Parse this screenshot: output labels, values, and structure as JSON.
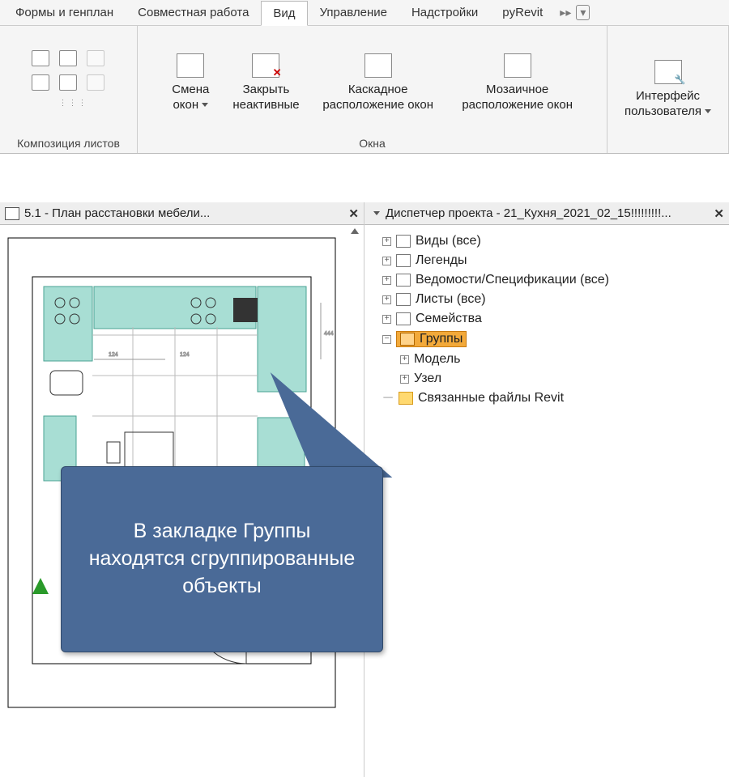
{
  "ribbon": {
    "tabs": [
      "Формы и генплан",
      "Совместная работа",
      "Вид",
      "Управление",
      "Надстройки",
      "pyRevit"
    ],
    "active_tab": "Вид",
    "group_composition": "Композиция листов",
    "group_windows": "Окна",
    "btn_switch": "Смена\nокон",
    "btn_close_inactive": "Закрыть\nнеактивные",
    "btn_cascade": "Каскадное\nрасположение окон",
    "btn_tile": "Мозаичное\nрасположение окон",
    "btn_ui": "Интерфейс\nпользователя"
  },
  "view_tab": {
    "title": "5.1 - План расстановки мебели..."
  },
  "browser": {
    "title": "Диспетчер проекта - 21_Кухня_2021_02_15!!!!!!!!!...",
    "items": {
      "views": "Виды (все)",
      "legends": "Легенды",
      "schedules": "Ведомости/Спецификации (все)",
      "sheets": "Листы (все)",
      "families": "Семейства",
      "groups": "Группы",
      "model": "Модель",
      "detail": "Узел",
      "links": "Связанные файлы Revit"
    }
  },
  "callout": {
    "text": "В закладке Группы находятся сгруппированные объекты"
  }
}
